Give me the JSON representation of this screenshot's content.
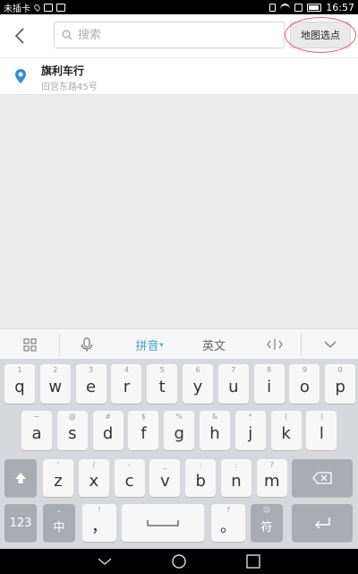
{
  "status": {
    "carrier": "未插卡",
    "time": "16:57"
  },
  "header": {
    "search_placeholder": "搜索",
    "map_button": "地图选点"
  },
  "result": {
    "title": "旗利车行",
    "subtitle": "旧宫东路45号"
  },
  "keyboard": {
    "toolbar": {
      "pinyin": "拼音",
      "english": "英文"
    },
    "row1": [
      {
        "main": "q",
        "sub": "1"
      },
      {
        "main": "w",
        "sub": "2"
      },
      {
        "main": "e",
        "sub": "3"
      },
      {
        "main": "r",
        "sub": "4"
      },
      {
        "main": "t",
        "sub": "5"
      },
      {
        "main": "y",
        "sub": "6"
      },
      {
        "main": "u",
        "sub": "7"
      },
      {
        "main": "i",
        "sub": "8"
      },
      {
        "main": "o",
        "sub": "9"
      },
      {
        "main": "p",
        "sub": "0"
      }
    ],
    "row2": [
      {
        "main": "a",
        "sub": "~"
      },
      {
        "main": "s",
        "sub": "@"
      },
      {
        "main": "d",
        "sub": "#"
      },
      {
        "main": "f",
        "sub": "$"
      },
      {
        "main": "g",
        "sub": "%"
      },
      {
        "main": "h",
        "sub": "&"
      },
      {
        "main": "j",
        "sub": "*"
      },
      {
        "main": "k",
        "sub": "("
      },
      {
        "main": "l",
        "sub": ")"
      }
    ],
    "row3": [
      {
        "main": "z",
        "sub": "'"
      },
      {
        "main": "x",
        "sub": "/"
      },
      {
        "main": "c",
        "sub": "-"
      },
      {
        "main": "v",
        "sub": "_"
      },
      {
        "main": "b",
        "sub": ":"
      },
      {
        "main": "n",
        "sub": ";"
      },
      {
        "main": "m",
        "sub": "?"
      }
    ],
    "row4": {
      "num": "123",
      "zh": "中",
      "zh_sub": "⌄",
      "comma": "，",
      "comma_sub": "!",
      "period": "。",
      "period_sub": "?",
      "symbol": "符",
      "symbol_sub": "☺"
    }
  },
  "icons": {
    "back": "chevron-left-icon",
    "search": "search-icon",
    "pin": "location-pin-icon",
    "grid": "grid-icon",
    "mic": "microphone-icon",
    "cursor": "cursor-move-icon",
    "collapse": "chevron-down-icon",
    "shift": "shift-icon",
    "delete": "backspace-icon",
    "enter": "enter-icon",
    "space": "space-icon"
  },
  "colors": {
    "accent": "#3fa7c8",
    "pin": "#2a8fd6",
    "highlight_ring": "#e06070"
  }
}
